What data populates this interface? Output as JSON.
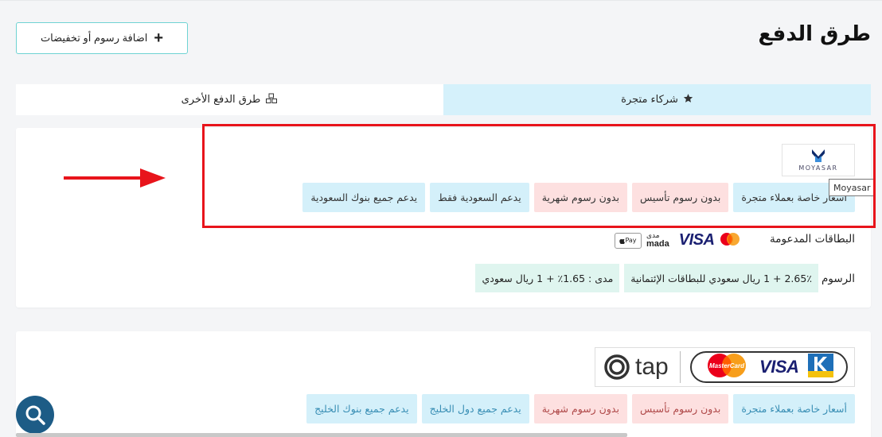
{
  "page": {
    "title": "طرق الدفع",
    "add_fees_label": "اضافة رسوم أو تخفيضات"
  },
  "tabs": [
    {
      "label": "شركاء متجرة",
      "icon": "star-icon",
      "active": true
    },
    {
      "label": "طرق الدفع الأخرى",
      "icon": "cubes-icon",
      "active": false
    }
  ],
  "moyasar": {
    "logo_text": "MOYASAR",
    "tooltip": "Moyasar",
    "badges": [
      {
        "text": "أسعار خاصة بعملاء متجرة",
        "style": "blue"
      },
      {
        "text": "بدون رسوم تأسيس",
        "style": "pink"
      },
      {
        "text": "بدون رسوم شهرية",
        "style": "pink"
      },
      {
        "text": "يدعم السعودية فقط",
        "style": "blue"
      },
      {
        "text": "يدعم جميع بنوك السعودية",
        "style": "blue"
      }
    ],
    "cards_label": "البطاقات المدعومة",
    "cards": {
      "visa": "VISA",
      "mada_ar": "مدى",
      "mada_en": "mada",
      "applepay": "Pay"
    },
    "fees_label": "الرسوم",
    "fees": [
      "2.65٪ + 1 ريال سعودي للبطاقات الإئتمانية",
      "مدى : 1.65٪ + 1 ريال سعودي"
    ]
  },
  "tap": {
    "word": "tap",
    "visa": "VISA",
    "mastercard": "MasterCard",
    "badges": [
      {
        "text": "أسعار خاصة بعملاء متجرة",
        "style": "blue2"
      },
      {
        "text": "بدون رسوم تأسيس",
        "style": "pink2"
      },
      {
        "text": "بدون رسوم شهرية",
        "style": "pink2"
      },
      {
        "text": "يدعم جميع دول الخليج",
        "style": "blue2"
      },
      {
        "text": "يدعم جميع بنوك الخليج",
        "style": "blue2"
      }
    ]
  },
  "colors": {
    "highlight": "#e8141b",
    "active_tab": "#d5f1fb",
    "fab": "#1d5c86"
  }
}
